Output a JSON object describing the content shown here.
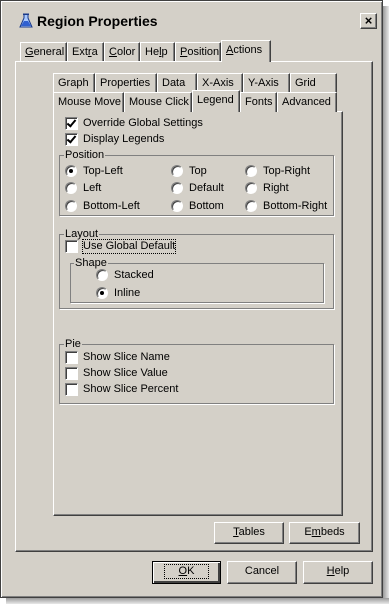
{
  "window": {
    "title": "Region Properties",
    "close_glyph": "×"
  },
  "outer_tabs": [
    {
      "label": "General",
      "mnemonic": "G",
      "rest": "eneral"
    },
    {
      "label": "Extra",
      "pre": "Ext",
      "mnemonic": "r",
      "rest": "a"
    },
    {
      "label": "Color",
      "mnemonic": "C",
      "rest": "olor"
    },
    {
      "label": "Help",
      "pre": "He",
      "mnemonic": "l",
      "rest": "p"
    },
    {
      "label": "Position",
      "mnemonic": "P",
      "rest": "osition"
    },
    {
      "label": "Actions",
      "mnemonic": "A",
      "rest": "ctions",
      "active": true
    }
  ],
  "inner_tabs_row1": [
    "Graph",
    "Properties",
    "Data",
    "X-Axis",
    "Y-Axis",
    "Grid"
  ],
  "inner_tabs_row2": [
    "Mouse Move",
    "Mouse Click",
    "Legend",
    "Fonts",
    "Advanced"
  ],
  "active_inner_tab": "Legend",
  "legend": {
    "override_global": {
      "label": "Override Global Settings",
      "checked": true
    },
    "display_legends": {
      "label": "Display Legends",
      "checked": true
    },
    "position": {
      "title": "Position",
      "options": [
        "Top-Left",
        "Top",
        "Top-Right",
        "Left",
        "Default",
        "Right",
        "Bottom-Left",
        "Bottom",
        "Bottom-Right"
      ],
      "selected": "Top-Left"
    },
    "layout": {
      "title": "Layout",
      "use_global_default": {
        "label": "Use Global Default",
        "checked": false
      },
      "shape": {
        "title": "Shape",
        "options": [
          "Stacked",
          "Inline"
        ],
        "selected": "Inline"
      }
    },
    "pie": {
      "title": "Pie",
      "show_slice_name": {
        "label": "Show Slice Name",
        "checked": false
      },
      "show_slice_value": {
        "label": "Show Slice Value",
        "checked": false
      },
      "show_slice_percent": {
        "label": "Show Slice Percent",
        "checked": false
      }
    }
  },
  "panel_buttons": {
    "tables": "Tables",
    "tables_mn": "T",
    "tables_rest": "ables",
    "embeds": "Embeds",
    "embeds_pre": "E",
    "embeds_mn": "m",
    "embeds_rest": "beds"
  },
  "dialog_buttons": {
    "ok": "OK",
    "ok_mn": "O",
    "ok_rest": "K",
    "cancel": "Cancel",
    "help": "Help",
    "help_mn": "H",
    "help_rest": "elp"
  }
}
